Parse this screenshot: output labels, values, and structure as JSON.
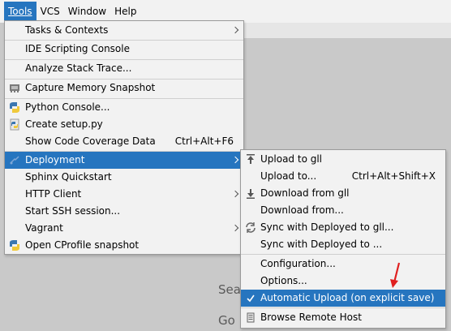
{
  "menubar": {
    "items": [
      "Tools",
      "VCS",
      "Window",
      "Help"
    ]
  },
  "tools_menu": {
    "items": [
      {
        "label": "Tasks & Contexts",
        "submenu": true
      },
      {
        "label": "IDE Scripting Console"
      },
      {
        "label": "Analyze Stack Trace..."
      },
      {
        "label": "Capture Memory Snapshot",
        "icon": "memory-snapshot-icon"
      },
      {
        "label": "Python Console...",
        "icon": "python-icon"
      },
      {
        "label": "Create setup.py",
        "icon": "python-file-icon"
      },
      {
        "label": "Show Code Coverage Data",
        "shortcut": "Ctrl+Alt+F6"
      },
      {
        "label": "Deployment",
        "submenu": true,
        "selected": true,
        "icon": "deployment-icon"
      },
      {
        "label": "Sphinx Quickstart"
      },
      {
        "label": "HTTP Client",
        "submenu": true
      },
      {
        "label": "Start SSH session..."
      },
      {
        "label": "Vagrant",
        "submenu": true
      },
      {
        "label": "Open CProfile snapshot",
        "icon": "python-icon"
      }
    ]
  },
  "deployment_menu": {
    "items": [
      {
        "label": "Upload to gll",
        "icon": "upload-icon"
      },
      {
        "label": "Upload to...",
        "shortcut": "Ctrl+Alt+Shift+X"
      },
      {
        "label": "Download from gll",
        "icon": "download-icon"
      },
      {
        "label": "Download from..."
      },
      {
        "label": "Sync with Deployed to gll...",
        "icon": "sync-icon"
      },
      {
        "label": "Sync with Deployed to ..."
      },
      {
        "label": "Configuration..."
      },
      {
        "label": "Options..."
      },
      {
        "label": "Automatic Upload (on explicit save)",
        "checked": true,
        "selected": true
      },
      {
        "label": "Browse Remote Host",
        "icon": "remote-host-icon"
      }
    ]
  },
  "background": {
    "search_text": "Sea",
    "goto_text": "Go"
  },
  "colors": {
    "selection": "#2675bf",
    "menu_bg": "#f2f2f2",
    "annotation_arrow": "#e02020"
  }
}
